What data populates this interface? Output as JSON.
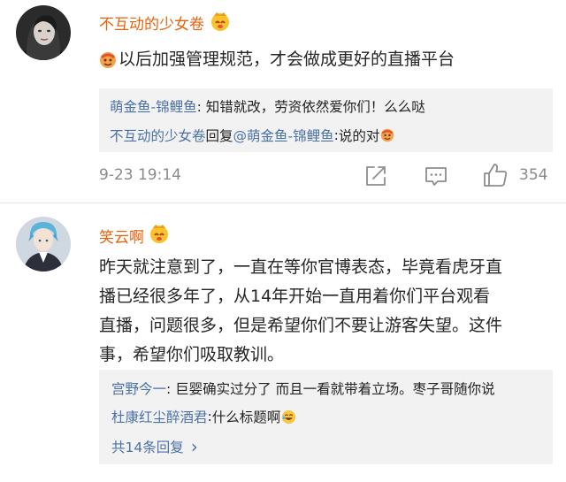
{
  "comments": [
    {
      "username": "不互动的少女卷",
      "text": "以后加强管理规范，才会做成更好的直播平台",
      "replies": [
        {
          "author": "萌金鱼-锦鲤鱼",
          "sep": ": ",
          "text": "知错就改，劳资依然爱你们！么么哒"
        },
        {
          "author": "不互动的少女卷",
          "verb": "回复",
          "mention": "@萌金鱼-锦鲤鱼",
          "sep": ":",
          "text": "说的对"
        }
      ],
      "time": "9-23 19:14",
      "likes": "354"
    },
    {
      "username": "笑云啊",
      "text_lines": [
        "昨天就注意到了，一直在等你官博表态，毕竟看虎牙直",
        "播已经很多年了，从14年开始一直用着你们平台观看",
        "直播，问题很多，但是希望你们不要让游客失望。这件",
        "事，希望你们吸取教训。"
      ],
      "replies": [
        {
          "author": "宫野今一",
          "sep": ": ",
          "text": "巨婴确实过分了 而且一看就带着立场。枣子哥随你说"
        },
        {
          "author": "杜康红尘醉酒君",
          "sep": ": ",
          "text": "什么标题啊"
        }
      ],
      "more_replies": "共14条回复",
      "more_chevron": "›"
    }
  ],
  "icons": [
    "crown-icon",
    "face-emoji-icon",
    "share-icon",
    "comment-icon",
    "like-icon",
    "laugh-emoji-icon"
  ],
  "colors": {
    "username": "#e8620d",
    "reply_name": "#4a71a8",
    "reply_bg": "#f2f2f2",
    "meta": "#8a8a8a"
  }
}
